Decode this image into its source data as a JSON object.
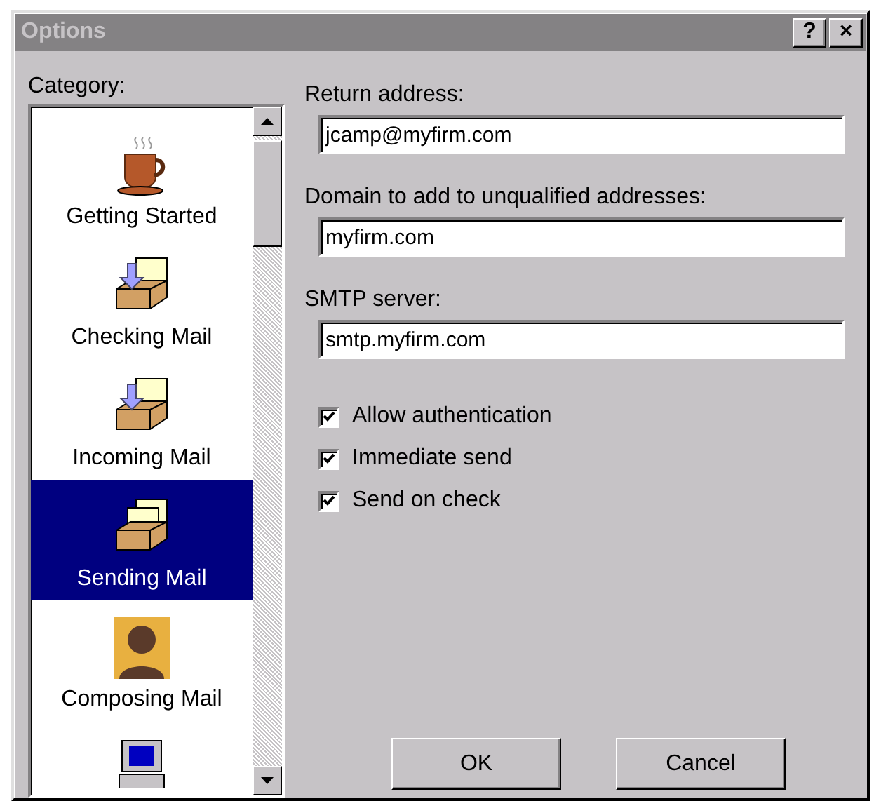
{
  "window": {
    "title": "Options",
    "active": false,
    "title_buttons": [
      {
        "kind": "help",
        "label": "?"
      },
      {
        "kind": "close",
        "label": "×"
      }
    ]
  },
  "category": {
    "label": "Category:",
    "items": [
      {
        "kind": "cup",
        "label": "Getting Started",
        "selected": false
      },
      {
        "kind": "inbox",
        "label": "Checking Mail",
        "selected": false
      },
      {
        "kind": "inbox",
        "label": "Incoming Mail",
        "selected": false
      },
      {
        "kind": "outbox",
        "label": "Sending Mail",
        "selected": true
      },
      {
        "kind": "person",
        "label": "Composing Mail",
        "selected": false
      },
      {
        "kind": "computer",
        "selected": false
      }
    ]
  },
  "fields": [
    {
      "label": "Return address:",
      "value": "jcamp@myfirm.com"
    },
    {
      "label": "Domain to add to unqualified addresses:",
      "value": "myfirm.com"
    },
    {
      "label": "SMTP server:",
      "value": "smtp.myfirm.com"
    }
  ],
  "checkboxes": [
    {
      "label": "Allow authentication",
      "checked": true
    },
    {
      "label": "Immediate send",
      "checked": true
    },
    {
      "label": "Send on check",
      "checked": true
    }
  ],
  "buttons": [
    {
      "label": "OK"
    },
    {
      "label": "Cancel"
    }
  ]
}
